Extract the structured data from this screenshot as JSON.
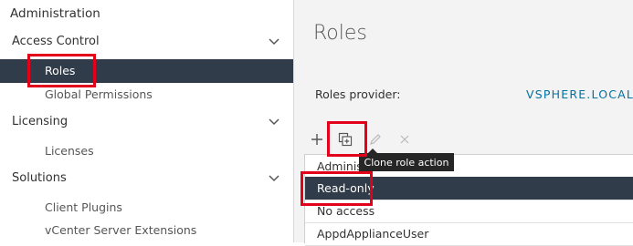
{
  "sidebar": {
    "title": "Administration",
    "sections": [
      {
        "label": "Access Control",
        "items": [
          "Roles",
          "Global Permissions"
        ]
      },
      {
        "label": "Licensing",
        "items": [
          "Licenses"
        ]
      },
      {
        "label": "Solutions",
        "items": [
          "Client Plugins",
          "vCenter Server Extensions"
        ]
      }
    ],
    "active_item": "Roles"
  },
  "main": {
    "title": "Roles",
    "provider_label": "Roles provider:",
    "provider_value": "VSPHERE.LOCAL",
    "toolbar": {
      "add_icon": "plus-icon",
      "clone_icon": "clone-icon",
      "edit_icon": "pencil-icon",
      "delete_icon": "x-icon"
    },
    "tooltip": "Clone role action",
    "roles": [
      "Adminis",
      "Read-only",
      "No access",
      "AppdApplianceUser"
    ],
    "selected_role": "Read-only"
  },
  "colors": {
    "selection": "#313c4a",
    "link": "#0072a3",
    "annotation": "#e2001a"
  }
}
